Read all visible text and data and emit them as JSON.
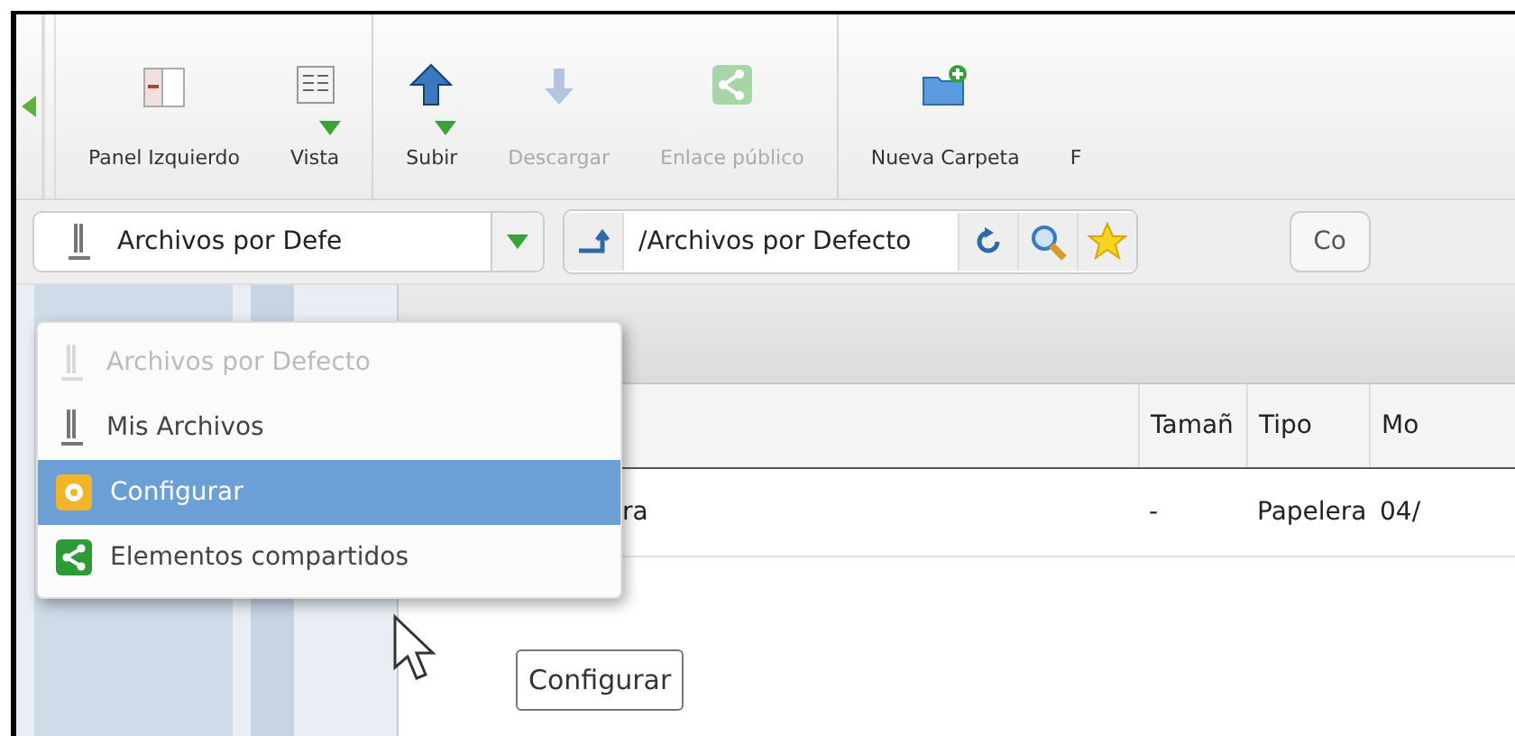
{
  "toolbar": {
    "groups": [
      {
        "buttons": [
          {
            "kind": "panel",
            "label": "Panel Izquierdo",
            "disabled": false,
            "dropdown": false
          },
          {
            "kind": "view",
            "label": "Vista",
            "disabled": false,
            "dropdown": true
          }
        ]
      },
      {
        "buttons": [
          {
            "kind": "upload",
            "label": "Subir",
            "disabled": false,
            "dropdown": true
          },
          {
            "kind": "download",
            "label": "Descargar",
            "disabled": true,
            "dropdown": false
          },
          {
            "kind": "share",
            "label": "Enlace público",
            "disabled": true,
            "dropdown": false
          }
        ]
      },
      {
        "buttons": [
          {
            "kind": "new-folder",
            "label": "Nueva Carpeta",
            "disabled": false,
            "dropdown": false
          },
          {
            "kind": "cut",
            "label": "F",
            "disabled": false,
            "dropdown": false
          }
        ]
      }
    ]
  },
  "location_bar": {
    "storage": "Archivos por Defe",
    "path": "/Archivos por Defecto",
    "button_cut": "Co"
  },
  "table": {
    "columns": [
      "Tamañ",
      "Tipo",
      "Mo"
    ],
    "rows": [
      {
        "name": "ra",
        "size": "-",
        "type": "Papelera",
        "modified": "04/"
      }
    ]
  },
  "menu": {
    "items": [
      {
        "kind": "storage",
        "label": "Archivos por Defecto",
        "disabled": true,
        "selected": false
      },
      {
        "kind": "storage",
        "label": "Mis Archivos",
        "disabled": false,
        "selected": false
      },
      {
        "kind": "settings",
        "label": "Configurar",
        "disabled": false,
        "selected": true
      },
      {
        "kind": "share",
        "label": "Elementos compartidos",
        "disabled": false,
        "selected": false
      }
    ]
  },
  "tooltip": "Configurar"
}
